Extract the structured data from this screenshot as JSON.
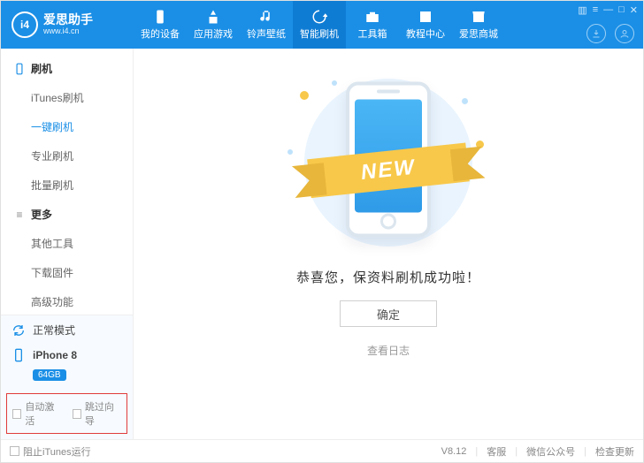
{
  "brand": {
    "title": "爱思助手",
    "sub": "www.i4.cn",
    "logo_text": "i4"
  },
  "nav": [
    {
      "label": "我的设备",
      "icon": "device"
    },
    {
      "label": "应用游戏",
      "icon": "app"
    },
    {
      "label": "铃声壁纸",
      "icon": "music"
    },
    {
      "label": "智能刷机",
      "icon": "refresh"
    },
    {
      "label": "工具箱",
      "icon": "toolbox"
    },
    {
      "label": "教程中心",
      "icon": "book"
    },
    {
      "label": "爱思商城",
      "icon": "store"
    }
  ],
  "nav_active_index": 3,
  "sidebar": {
    "section1": {
      "title": "刷机",
      "items": [
        "iTunes刷机",
        "一键刷机",
        "专业刷机",
        "批量刷机"
      ],
      "active_index": 1
    },
    "section2": {
      "title": "更多",
      "items": [
        "其他工具",
        "下载固件",
        "高级功能"
      ]
    }
  },
  "device_panel": {
    "mode": "正常模式",
    "model": "iPhone 8",
    "storage": "64GB"
  },
  "highlight_checks": {
    "auto_activate": "自动激活",
    "skip_wizard": "跳过向导"
  },
  "main": {
    "ribbon": "NEW",
    "message": "恭喜您，保资料刷机成功啦！",
    "ok": "确定",
    "log": "查看日志"
  },
  "footer": {
    "block_itunes": "阻止iTunes运行",
    "version": "V8.12",
    "service": "客服",
    "wechat": "微信公众号",
    "update": "检查更新"
  }
}
